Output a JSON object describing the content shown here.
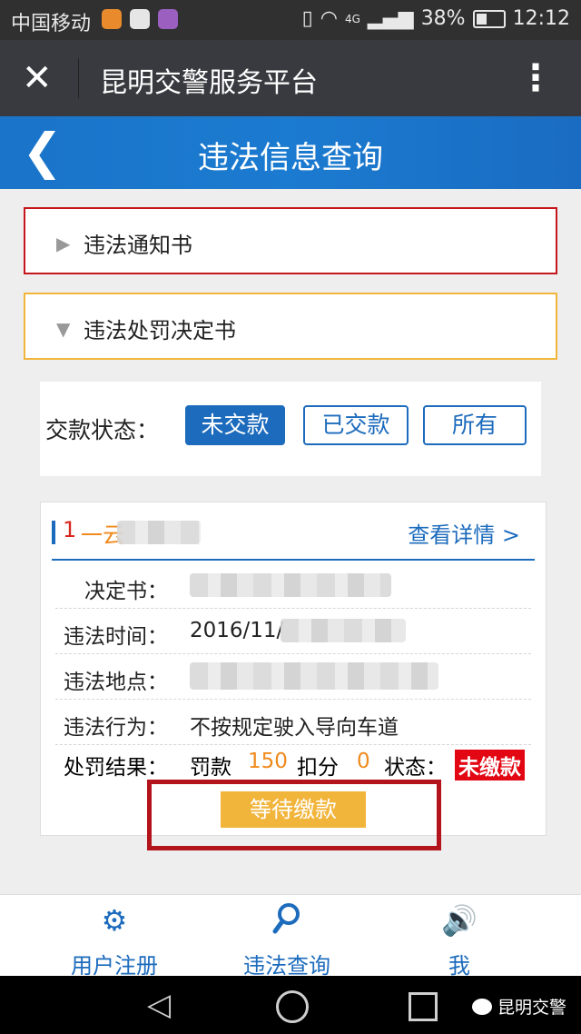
{
  "status_bar": {
    "carrier": "中国移动",
    "network": "4G",
    "battery": "38%",
    "time": "12:12"
  },
  "wechat_bar": {
    "close": "✕",
    "title": "昆明交警服务平台",
    "more": "⋮"
  },
  "page_header": {
    "back": "❮",
    "title": "违法信息查询"
  },
  "sections": {
    "notice_label": "违法通知书",
    "decision_label": "违法处罚决定书"
  },
  "payment_filter": {
    "label": "交款状态：",
    "options": [
      "未交款",
      "已交款",
      "所有"
    ],
    "selected": "未交款"
  },
  "record": {
    "seq": "1",
    "plate_prefix": "一云",
    "detail_link": "查看详情 >",
    "fields": [
      {
        "key": "决定书：",
        "value": ""
      },
      {
        "key": "违法时间：",
        "value": "2016/11/"
      },
      {
        "key": "违法地点：",
        "value": ""
      },
      {
        "key": "违法行为：",
        "value": "不按规定驶入导向车道"
      }
    ],
    "result": {
      "key": "处罚结果：",
      "fine_label": "罚款",
      "fine": "150",
      "points_label": "扣分",
      "points": "0",
      "status_label": "状态：",
      "status": "未缴款"
    },
    "action": "等待缴款"
  },
  "tab_bar": [
    {
      "label": "用户注册",
      "icon": "gear-icon"
    },
    {
      "label": "违法查询",
      "icon": "search-icon"
    },
    {
      "label": "我",
      "icon": "speaker-icon"
    }
  ],
  "watermark": "昆明交警",
  "colors": {
    "primary": "#1c6bbd",
    "notice_border": "#c4161c",
    "decision_border": "#f2b53c",
    "pay_button": "#f2b53c",
    "unpaid_badge": "#e30613",
    "highlight": "#b3141b"
  }
}
